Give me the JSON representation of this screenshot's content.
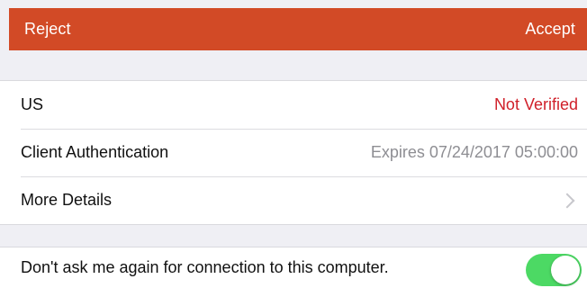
{
  "header": {
    "reject_label": "Reject",
    "accept_label": "Accept",
    "accent_color": "#d24a26"
  },
  "certificate": {
    "subject": "US",
    "status": "Not Verified",
    "status_color": "#d0202a",
    "purpose": "Client Authentication",
    "expiry": "Expires 07/24/2017 05:00:00",
    "details_label": "More Details"
  },
  "preference": {
    "label": "Don't ask me again for connection to this computer.",
    "toggle_on": true,
    "toggle_color": "#4cd964"
  }
}
